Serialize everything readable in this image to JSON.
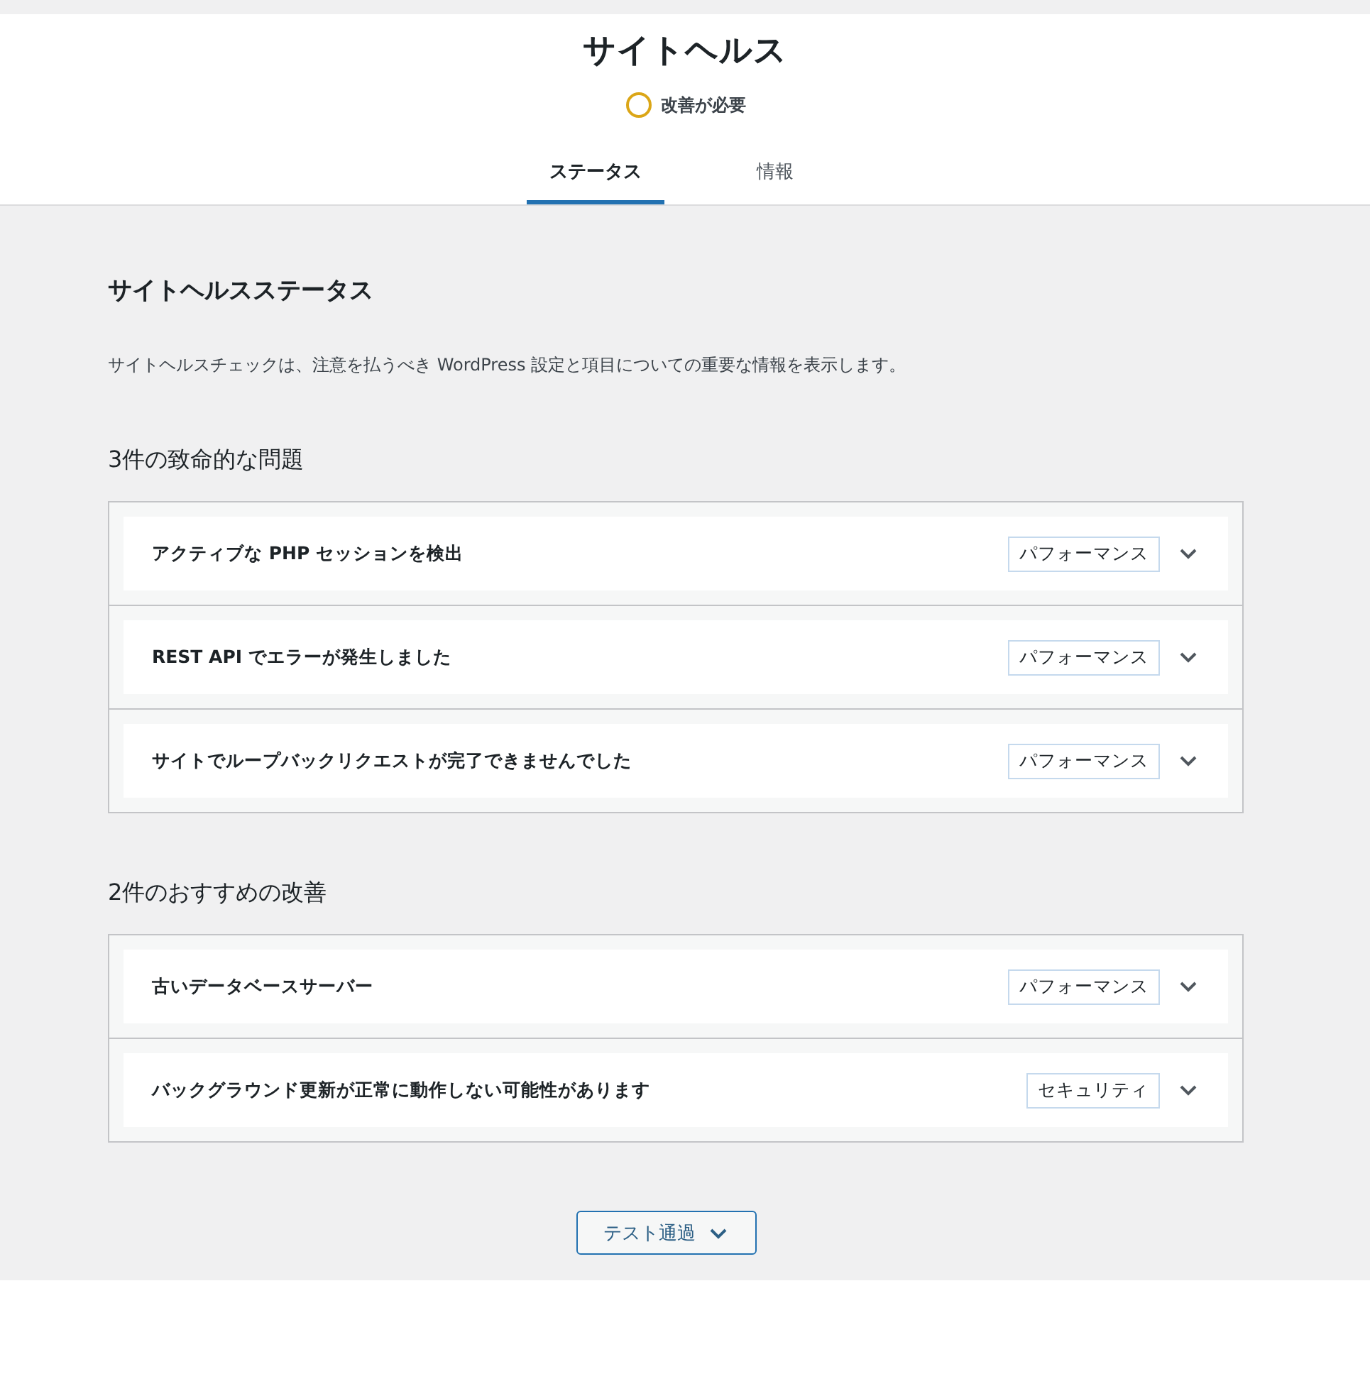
{
  "header": {
    "title": "サイトヘルス",
    "status": {
      "label": "改善が必要"
    }
  },
  "tabs": [
    {
      "label": "ステータス",
      "selected": true
    },
    {
      "label": "情報",
      "selected": false
    }
  ],
  "main": {
    "heading": "サイトヘルスステータス",
    "description": "サイトヘルスチェックは、注意を払うべき WordPress 設定と項目についての重要な情報を表示します。",
    "groups": [
      {
        "title": "3件の致命的な問題",
        "issues": [
          {
            "label": "アクティブな PHP セッションを検出",
            "badge": "パフォーマンス",
            "expanded": false
          },
          {
            "label": "REST API でエラーが発生しました",
            "badge": "パフォーマンス",
            "expanded": false
          },
          {
            "label": "サイトでループバックリクエストが完了できませんでした",
            "badge": "パフォーマンス",
            "expanded": false
          }
        ]
      },
      {
        "title": "2件のおすすめの改善",
        "issues": [
          {
            "label": "古いデータベースサーバー",
            "badge": "パフォーマンス",
            "expanded": false
          },
          {
            "label": "バックグラウンド更新が正常に動作しない可能性があります",
            "badge": "セキュリティ",
            "expanded": false
          }
        ]
      }
    ],
    "passed_button": {
      "label": "テスト通過",
      "expanded": false
    }
  }
}
